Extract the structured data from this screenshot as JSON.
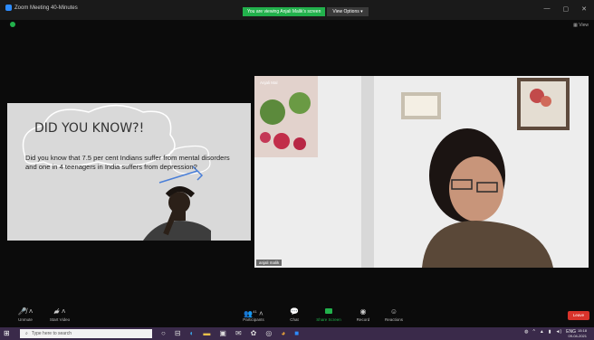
{
  "window": {
    "title": "Zoom Meeting 40-Minutes"
  },
  "banner": {
    "viewing": "You are viewing Anjali Malik's screen",
    "view_options": "View Options"
  },
  "top_right": {
    "view_label": "View"
  },
  "slide": {
    "heading": "DID YOU KNOW?!",
    "body": "Did you know that 7.5 per cent Indians suffer from mental disorders and one in 4 teenagers in India suffers from depression?"
  },
  "camera": {
    "name_top": "Anjali Mal",
    "name_bottom": "anjali malik"
  },
  "toolbar": {
    "unmute": "Unmute",
    "start_video": "Start Video",
    "participants": "Participants",
    "participants_count": "41",
    "chat": "Chat",
    "share_screen": "Share Screen",
    "record": "Record",
    "reactions": "Reactions",
    "leave": "Leave"
  },
  "taskbar": {
    "search_placeholder": "Type here to search",
    "time": "15:18",
    "date": "09-04-2021",
    "lang": "ENG"
  },
  "colors": {
    "zoom_green": "#22b14c",
    "leave_red": "#d9332b",
    "zoom_blue": "#2d8cff"
  }
}
